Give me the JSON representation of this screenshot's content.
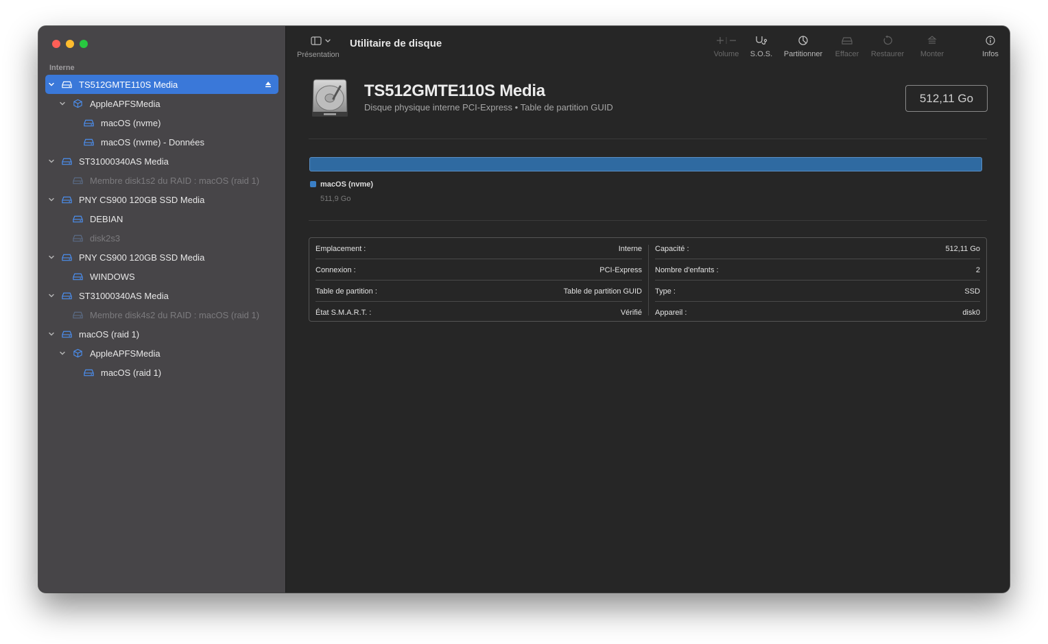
{
  "app": {
    "title": "Utilitaire de disque"
  },
  "toolbar": {
    "presentation_label": "Présentation",
    "buttons": [
      {
        "label": "Volume",
        "icon": "plus-minus-icon",
        "enabled": false
      },
      {
        "label": "S.O.S.",
        "icon": "stethoscope-icon",
        "enabled": true
      },
      {
        "label": "Partitionner",
        "icon": "pie-chart-icon",
        "enabled": true
      },
      {
        "label": "Effacer",
        "icon": "erase-disk-icon",
        "enabled": false
      },
      {
        "label": "Restaurer",
        "icon": "restore-icon",
        "enabled": false
      },
      {
        "label": "Monter",
        "icon": "mount-icon",
        "enabled": false
      },
      {
        "label": "Infos",
        "icon": "info-icon",
        "enabled": true
      }
    ]
  },
  "sidebar": {
    "section": "Interne",
    "items": [
      {
        "label": "TS512GMTE110S Media",
        "icon": "drive-icon",
        "selected": true,
        "expanded": true,
        "eject": true
      },
      {
        "label": "AppleAPFSMedia",
        "icon": "apfs-container-icon",
        "expanded": true
      },
      {
        "label": "macOS (nvme)",
        "icon": "volume-icon"
      },
      {
        "label": "macOS (nvme) - Données",
        "icon": "volume-icon"
      },
      {
        "label": "ST31000340AS Media",
        "icon": "drive-icon",
        "expanded": true
      },
      {
        "label": "Membre disk1s2 du RAID : macOS (raid 1)",
        "icon": "volume-icon",
        "dim": true
      },
      {
        "label": "PNY CS900 120GB SSD Media",
        "icon": "drive-icon",
        "expanded": true
      },
      {
        "label": "DEBIAN",
        "icon": "volume-icon"
      },
      {
        "label": "disk2s3",
        "icon": "volume-icon",
        "dim": true
      },
      {
        "label": "PNY CS900 120GB SSD Media",
        "icon": "drive-icon",
        "expanded": true
      },
      {
        "label": "WINDOWS",
        "icon": "volume-icon"
      },
      {
        "label": "ST31000340AS Media",
        "icon": "drive-icon",
        "expanded": true
      },
      {
        "label": "Membre disk4s2 du RAID : macOS (raid 1)",
        "icon": "volume-icon",
        "dim": true
      },
      {
        "label": "macOS (raid 1)",
        "icon": "drive-icon",
        "expanded": true
      },
      {
        "label": "AppleAPFSMedia",
        "icon": "apfs-container-icon",
        "expanded": true
      },
      {
        "label": "macOS (raid 1)",
        "icon": "volume-icon"
      }
    ]
  },
  "disk": {
    "name": "TS512GMTE110S Media",
    "description": "Disque physique interne PCI-Express • Table de partition GUID",
    "capacity": "512,11 Go"
  },
  "usage": {
    "color": "#2f6aa1",
    "partitions": [
      {
        "name": "macOS (nvme)",
        "size": "511,9 Go",
        "fraction": 1.0
      }
    ]
  },
  "info": {
    "left": [
      {
        "key": "Emplacement :",
        "value": "Interne"
      },
      {
        "key": "Connexion :",
        "value": "PCI-Express"
      },
      {
        "key": "Table de partition :",
        "value": "Table de partition GUID"
      },
      {
        "key": "État S.M.A.R.T. :",
        "value": "Vérifié"
      }
    ],
    "right": [
      {
        "key": "Capacité :",
        "value": "512,11 Go"
      },
      {
        "key": "Nombre d'enfants :",
        "value": "2"
      },
      {
        "key": "Type :",
        "value": "SSD"
      },
      {
        "key": "Appareil :",
        "value": "disk0"
      }
    ]
  },
  "colors": {
    "accent": "#3a78d9",
    "sidebar": "#474548",
    "content": "#262626"
  }
}
